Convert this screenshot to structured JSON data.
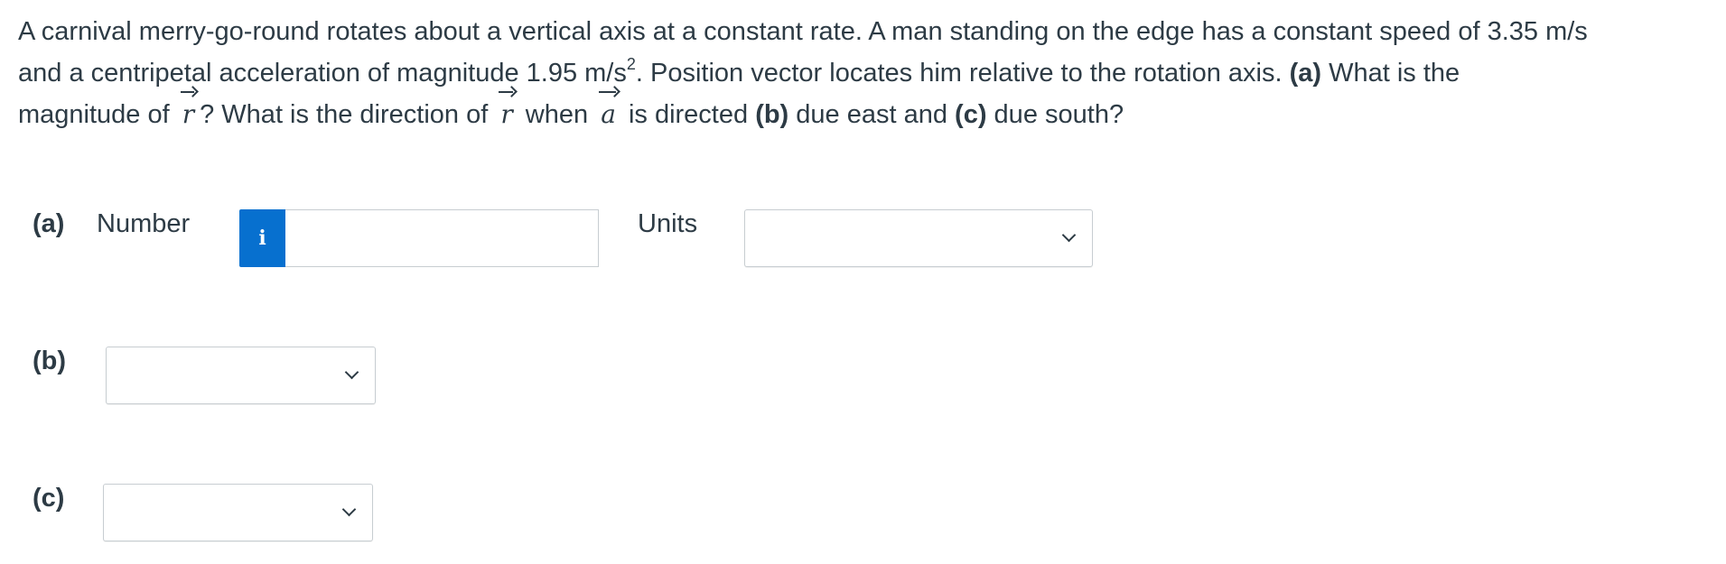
{
  "question": {
    "line1": "A carnival merry-go-round rotates about a vertical axis at a constant rate. A man standing on the edge has a constant speed of 3.35 m/s",
    "line2_a": "and a centripetal acceleration of magnitude 1.95 m/s",
    "line2_sup": "2",
    "line2_b": ". Position vector locates him relative to the rotation axis. ",
    "line2_part_a": "(a)",
    "line2_c": " What is the",
    "line3_a": "magnitude of ",
    "vec_r": "r",
    "line3_b": "? What is the direction of ",
    "line3_c": " when ",
    "vec_a": "a",
    "line3_d": " is directed ",
    "line3_part_b": "(b)",
    "line3_e": " due east and ",
    "line3_part_c": "(c)",
    "line3_f": " due south?"
  },
  "part_a": {
    "label": "(a)",
    "number_label": "Number",
    "info_glyph": "i",
    "number_value": "",
    "units_label": "Units",
    "units_value": ""
  },
  "part_b": {
    "label": "(b)",
    "value": ""
  },
  "part_c": {
    "label": "(c)",
    "value": ""
  }
}
